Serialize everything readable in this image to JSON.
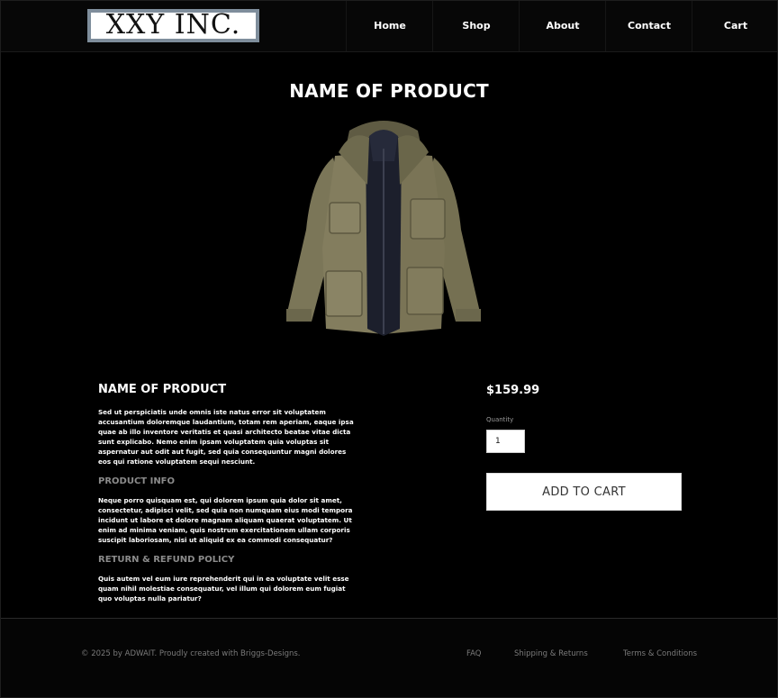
{
  "header": {
    "logo_text": "XXY INC.",
    "nav": [
      "Home",
      "Shop",
      "About",
      "Contact",
      "Cart"
    ]
  },
  "product": {
    "title": "NAME OF PRODUCT",
    "image_icon": "jacket-image",
    "name": "NAME OF PRODUCT",
    "description": "Sed ut perspiciatis unde omnis iste natus error sit voluptatem accusantium doloremque laudantium, totam rem aperiam, eaque ipsa quae ab illo inventore veritatis et quasi architecto beatae vitae dicta sunt explicabo. Nemo enim ipsam voluptatem quia voluptas sit aspernatur aut odit aut fugit, sed quia consequuntur magni dolores eos qui ratione voluptatem sequi nesciunt.",
    "info_heading": "PRODUCT INFO",
    "info_text": "Neque porro quisquam est, qui dolorem ipsum quia dolor sit amet, consectetur, adipisci velit, sed quia non numquam eius modi tempora incidunt ut labore et dolore magnam aliquam quaerat voluptatem. Ut enim ad minima veniam, quis nostrum exercitationem ullam corporis suscipit laboriosam, nisi ut aliquid ex ea commodi consequatur?",
    "policy_heading": "RETURN & REFUND POLICY",
    "policy_text": "Quis autem vel eum iure reprehenderit qui in ea voluptate velit esse quam nihil molestiae consequatur, vel illum qui dolorem eum fugiat quo voluptas nulla pariatur?",
    "price": "$159.99",
    "quantity_label": "Quantity",
    "quantity_value": "1",
    "add_to_cart": "ADD TO CART"
  },
  "footer": {
    "copyright": "© 2025 by ADWAIT. Proudly created with Briggs-Designs.",
    "links": [
      "FAQ",
      "Shipping & Returns",
      "Terms & Conditions"
    ]
  },
  "colors": {
    "background": "#000000",
    "logo_border": "#7f8e9c",
    "muted_heading": "#8b8b8b",
    "footer_text": "#7a7a7a"
  }
}
